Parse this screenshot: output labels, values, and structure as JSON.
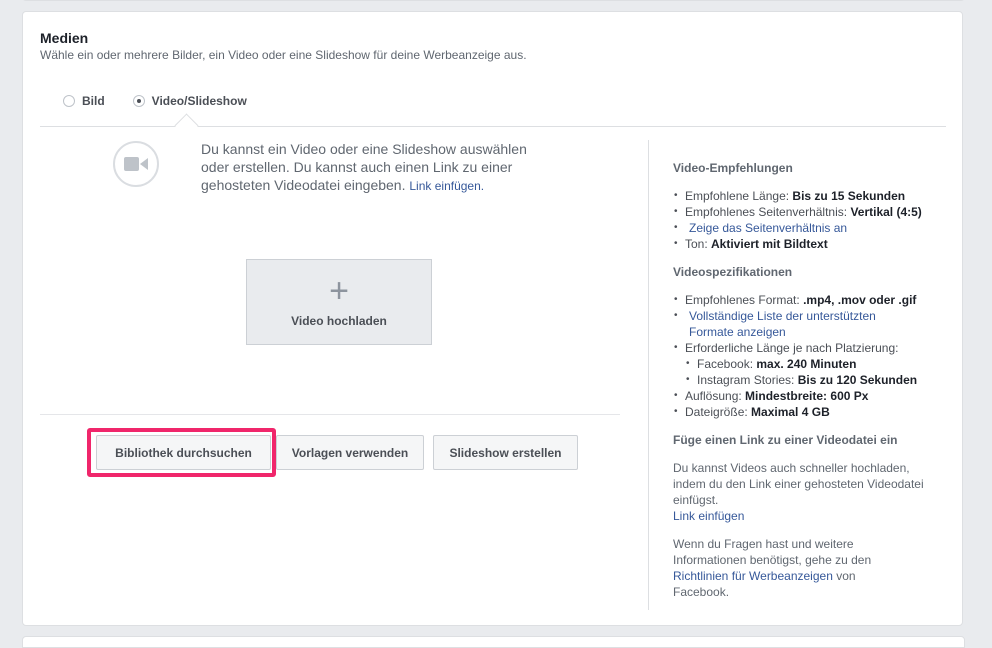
{
  "section": {
    "title": "Medien",
    "subtitle": "Wähle ein oder mehrere Bilder, ein Video oder eine Slideshow für deine Werbeanzeige aus."
  },
  "format_options": {
    "image": "Bild",
    "video": "Video/Slideshow",
    "selected": "Video/Slideshow"
  },
  "info": {
    "text": "Du kannst ein Video oder eine Slideshow auswählen oder erstellen. Du kannst auch einen Link zu einer gehosteten Videodatei eingeben.",
    "link": "Link einfügen."
  },
  "upload": {
    "plus": "+",
    "label": "Video hochladen"
  },
  "buttons": {
    "library": "Bibliothek durchsuchen",
    "templates": "Vorlagen verwenden",
    "slideshow": "Slideshow erstellen"
  },
  "highlight_color": "#f0266b",
  "sidebar": {
    "rec_heading": "Video-Empfehlungen",
    "rec": {
      "length_label": "Empfohlene Länge: ",
      "length_value": "Bis zu 15 Sekunden",
      "ratio_label": "Empfohlenes Seitenverhältnis: ",
      "ratio_value": "Vertikal (4:5)",
      "ratio_link": "Zeige das Seitenverhältnis an",
      "sound_label": "Ton: ",
      "sound_value": "Aktiviert mit Bildtext"
    },
    "spec_heading": "Videospezifikationen",
    "spec": {
      "format_label": "Empfohlenes Format: ",
      "format_value": ".mp4, .mov oder .gif",
      "format_link": "Vollständige Liste der unterstützten Formate anzeigen",
      "length_label": "Erforderliche Länge je nach Platzierung:",
      "facebook_label": "Facebook: ",
      "facebook_value": "max. 240 Minuten",
      "stories_label": "Instagram Stories: ",
      "stories_value": "Bis zu 120 Sekunden",
      "resolution_label": "Auflösung: ",
      "resolution_value": "Mindestbreite: 600 Px",
      "size_label": "Dateigröße: ",
      "size_value": "Maximal 4 GB"
    },
    "link_heading": "Füge einen Link zu einer Videodatei ein",
    "link_text": "Du kannst Videos auch schneller hochladen, indem du den Link einer gehosteten Videodatei einfügst.",
    "link_action": "Link einfügen",
    "help_text": "Wenn du Fragen hast und weitere Informationen benötigst, gehe zu den",
    "help_link": "Richtlinien für Werbeanzeigen",
    "help_suffix": " von Facebook."
  }
}
